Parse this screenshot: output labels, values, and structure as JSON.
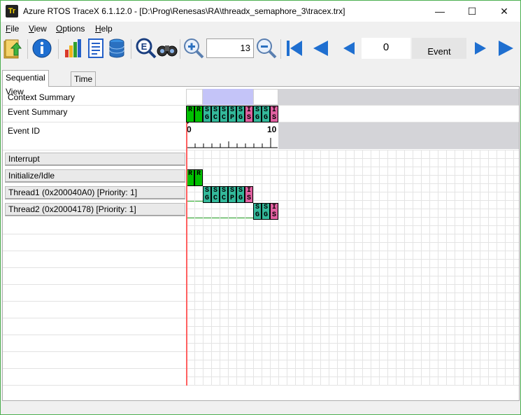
{
  "window": {
    "title": "Azure RTOS TraceX 6.1.12.0 - [D:\\Prog\\Renesas\\RA\\threadx_semaphore_3\\tracex.trx]",
    "app_icon_text": "Tr",
    "minimize": "—",
    "maximize": "☐",
    "close": "✕"
  },
  "menu": [
    {
      "key": "F",
      "rest": "ile"
    },
    {
      "key": "V",
      "rest": "iew"
    },
    {
      "key": "O",
      "rest": "ptions"
    },
    {
      "key": "H",
      "rest": "elp"
    }
  ],
  "toolbar": {
    "zoom_value": "13",
    "event_value": "0",
    "event_label": "Event",
    "icons": [
      "open-folder-icon",
      "info-icon",
      "bar-chart-icon",
      "report-icon",
      "database-icon",
      "search-event-icon",
      "binoculars-icon",
      "zoom-in-icon",
      "zoom-out-icon",
      "first-event-icon",
      "previous-page-icon",
      "previous-event-icon",
      "next-event-icon",
      "next-page-icon"
    ]
  },
  "tabs": [
    {
      "label": "Sequential View",
      "active": true
    },
    {
      "label": "Time View",
      "active": false
    }
  ],
  "rows": {
    "context_summary": "Context Summary",
    "event_summary": "Event Summary",
    "event_id": "Event ID",
    "interrupt": "Interrupt",
    "initialize_idle": "Initialize/Idle",
    "thread1": "Thread1 (0x200040A0) [Priority: 1]",
    "thread2": "Thread2 (0x20004178) [Priority: 1]"
  },
  "ruler": {
    "start": "0",
    "end": "10"
  },
  "colors": {
    "running": "#00c000",
    "semaphore": "#33b89a",
    "isr": "#e060a0",
    "context_thread": "#c4c4f8",
    "inactive": "#d4d4d8",
    "cursor": "#ff0000"
  },
  "events": [
    {
      "id": 0,
      "code": [
        "R",
        ""
      ],
      "type": "running",
      "row": "initialize_idle"
    },
    {
      "id": 1,
      "code": [
        "R",
        ""
      ],
      "type": "running",
      "row": "initialize_idle"
    },
    {
      "id": 2,
      "code": [
        "S",
        "G"
      ],
      "type": "semaphore",
      "row": "thread1"
    },
    {
      "id": 3,
      "code": [
        "S",
        "C"
      ],
      "type": "semaphore",
      "row": "thread1"
    },
    {
      "id": 4,
      "code": [
        "S",
        "C"
      ],
      "type": "semaphore",
      "row": "thread1"
    },
    {
      "id": 5,
      "code": [
        "S",
        "P"
      ],
      "type": "semaphore",
      "row": "thread1"
    },
    {
      "id": 6,
      "code": [
        "S",
        "G"
      ],
      "type": "semaphore",
      "row": "thread1"
    },
    {
      "id": 7,
      "code": [
        "I",
        "S"
      ],
      "type": "isr",
      "row": "thread1"
    },
    {
      "id": 8,
      "code": [
        "S",
        "G"
      ],
      "type": "semaphore",
      "row": "thread2"
    },
    {
      "id": 9,
      "code": [
        "S",
        "G"
      ],
      "type": "semaphore",
      "row": "thread2"
    },
    {
      "id": 10,
      "code": [
        "I",
        "S"
      ],
      "type": "isr",
      "row": "thread2"
    }
  ]
}
